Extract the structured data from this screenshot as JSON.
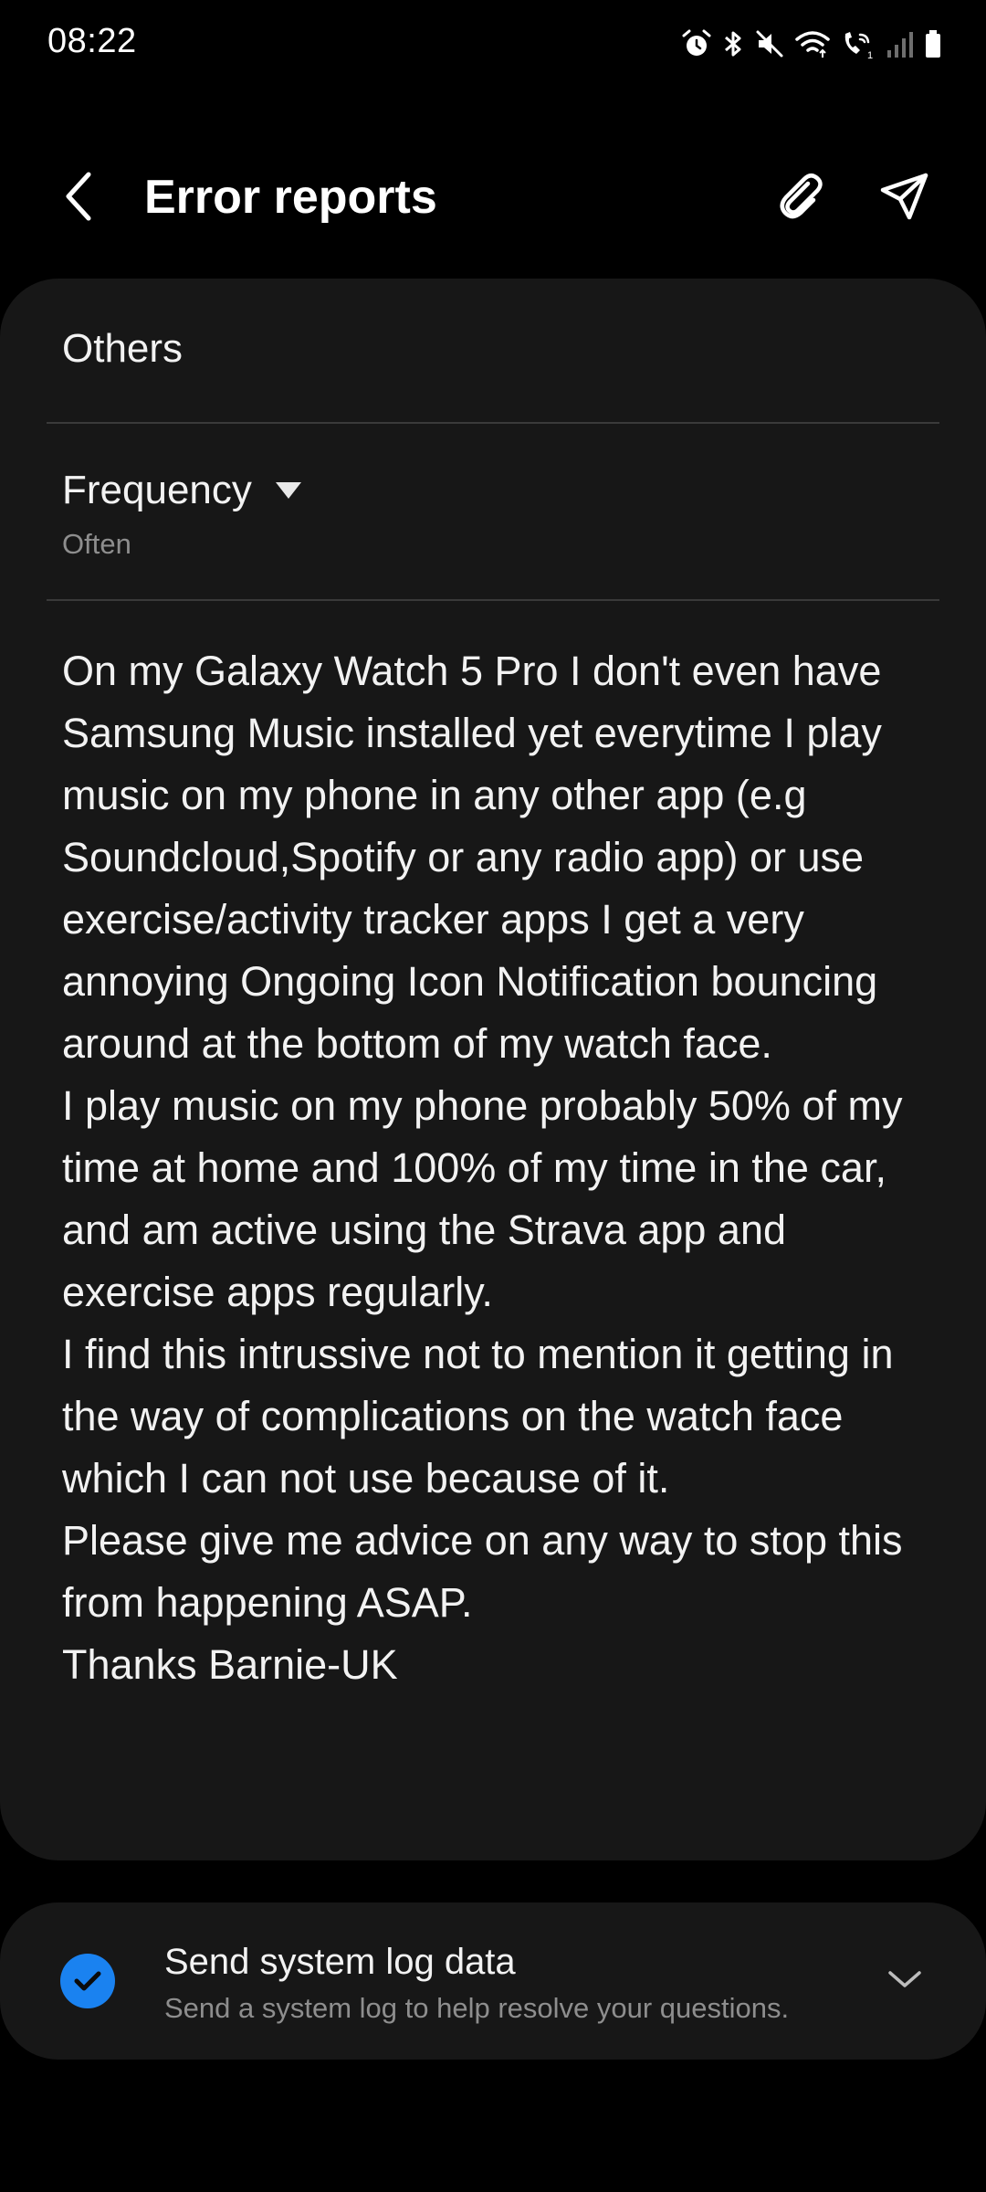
{
  "status_bar": {
    "time": "08:22",
    "icons": [
      "alarm-icon",
      "bluetooth-icon",
      "mute-icon",
      "wifi-icon",
      "wifi-calling-icon",
      "signal-icon",
      "battery-icon"
    ]
  },
  "app_bar": {
    "title": "Error reports",
    "back_icon": "back-arrow-icon",
    "attach_icon": "paperclip-icon",
    "send_icon": "send-icon"
  },
  "report": {
    "category": "Others",
    "frequency_label": "Frequency",
    "frequency_value": "Often",
    "body": "On my Galaxy Watch 5 Pro I don't even have Samsung Music installed yet everytime I play music on my phone in any other app (e.g Soundcloud,Spotify or any radio app) or use exercise/activity tracker apps I get a very annoying Ongoing Icon Notification bouncing around at the bottom of my watch face.\nI play music on my phone probably 50% of my time at home and 100% of my time in the car, and am active using the Strava app and exercise apps regularly.\nI find this intrussive not to mention it getting in the way of complications on the watch face which I can not use because of it.\nPlease give me advice on any way to stop this from happening ASAP.\nThanks Barnie-UK"
  },
  "system_log": {
    "title": "Send system log data",
    "subtitle": "Send a system log to help resolve your questions.",
    "checked": true
  },
  "colors": {
    "background": "#000000",
    "card": "#171717",
    "accent": "#1a82f0",
    "secondary_text": "#8e8e8e"
  }
}
